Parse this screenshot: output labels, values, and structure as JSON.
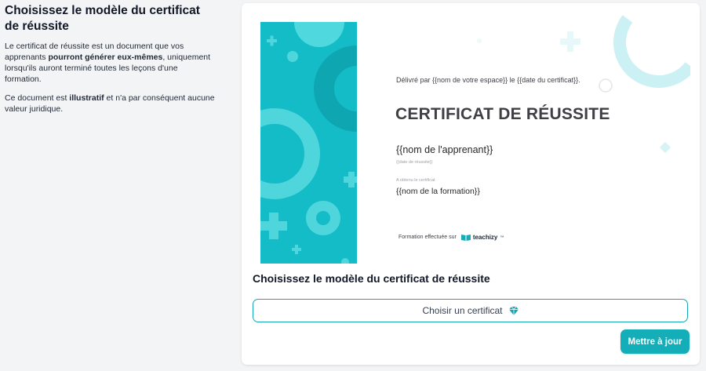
{
  "sidebar": {
    "title": "Choisissez le modèle du certificat de réussite",
    "desc1_before": "Le certificat de réussite est un document que vos apprenants ",
    "desc1_bold": "pourront générer eux-mêmes",
    "desc1_after": ", uniquement lorsqu'ils auront terminé toutes les leçons d'une formation.",
    "desc2_before": "Ce document est ",
    "desc2_bold": "illustratif",
    "desc2_after": " et n'a par conséquent aucune valeur juridique."
  },
  "certificate": {
    "issued_line": "Délivré par {{nom de votre espace}} le {{date du certificat}}.",
    "title": "CERTIFICAT DE RÉUSSITE",
    "learner": "{{nom de l'apprenant}}",
    "date_placeholder": "{{date de réussite}}",
    "obtained_label": "A obtenu le certificat",
    "training": "{{nom de la formation}}",
    "footer_text": "Formation effectuée sur",
    "brand_name": "teachizy",
    "brand_mark": "™"
  },
  "main": {
    "section_title": "Choisissez le modèle du certificat de réussite",
    "choose_label": "Choisir un certificat",
    "choose_icon": "gem-icon",
    "update_label": "Mettre à jour"
  },
  "colors": {
    "accent": "#14aeb8",
    "band": "#14bcc8"
  }
}
